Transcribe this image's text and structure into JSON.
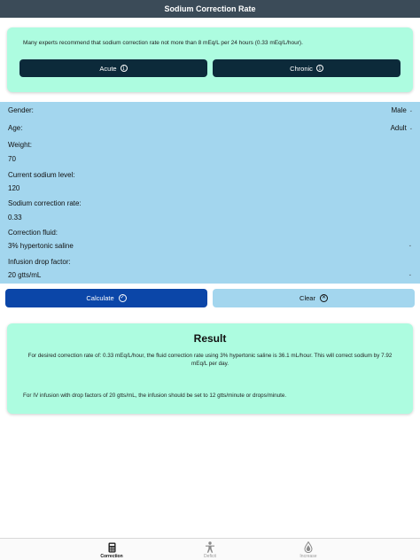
{
  "header": {
    "title": "Sodium Correction Rate"
  },
  "info": {
    "text": "Many experts recommend that sodium correction rate not more than 8 mEq/L per 24 hours (0.33 mEq/L/hour).",
    "acute_label": "Acute",
    "chronic_label": "Chronic",
    "info_glyph": "i"
  },
  "form": {
    "gender": {
      "label": "Gender:",
      "value": "Male"
    },
    "age": {
      "label": "Age:",
      "value": "Adult"
    },
    "weight": {
      "label": "Weight:",
      "value": "70"
    },
    "sodium_level": {
      "label": "Current sodium level:",
      "value": "120"
    },
    "correction_rate": {
      "label": "Sodium correction rate:",
      "value": "0.33"
    },
    "fluid": {
      "label": "Correction fluid:",
      "value": "3% hypertonic saline"
    },
    "drop_factor": {
      "label": "Infusion drop factor:",
      "value": "20 gtts/mL"
    },
    "chevron_glyph": "⌄"
  },
  "actions": {
    "calculate_label": "Calculate",
    "clear_label": "Clear",
    "check_glyph": "✓",
    "x_glyph": "✕"
  },
  "result": {
    "title": "Result",
    "line1": "For desired correction rate of: 0.33 mEq/L/hour, the fluid correction rate using 3% hypertonic saline is 36.1 mL/hour. This will correct sodium by 7.92 mEq/L per day.",
    "line2": "For IV infusion with drop factors of 20 gtts/mL, the infusion should be set to 12 gtts/minute or drops/minute."
  },
  "tabs": [
    {
      "label": "Correction",
      "icon": "calculator-icon",
      "active": true
    },
    {
      "label": "Deficit",
      "icon": "person-icon",
      "active": false
    },
    {
      "label": "Increase",
      "icon": "drop-icon",
      "active": false
    }
  ],
  "colors": {
    "header_bg": "#3b4b58",
    "card_mint": "#adfce0",
    "form_blue": "#a3d6ee",
    "dark_navy": "#0c2a3a",
    "calc_blue": "#0b46a8"
  }
}
